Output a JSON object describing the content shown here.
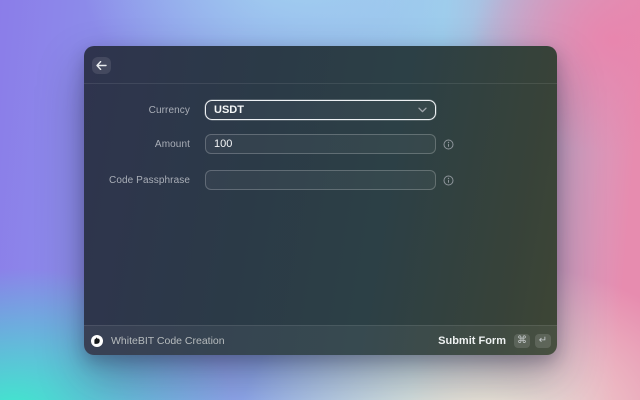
{
  "theme": {
    "bg_purple": "#8b7de9",
    "bg_periwinkle": "#8fa9ec",
    "bg_sky": "#9ccbeb",
    "bg_pink": "#e78caf",
    "bg_teal": "#3fe9cd",
    "bg_cream": "#f2ecd9",
    "window_left": "#2f344e",
    "window_right": "#3e4635",
    "focus_border": "#edf0f3"
  },
  "window": {
    "header": {
      "back_icon": "arrow-left"
    },
    "form": {
      "fields": [
        {
          "label": "Currency",
          "type": "dropdown",
          "value": "USDT",
          "has_info": false
        },
        {
          "label": "Amount",
          "type": "text",
          "value": "100",
          "placeholder": "",
          "has_info": true
        },
        {
          "label": "Code Passphrase",
          "type": "password",
          "value": "",
          "placeholder": "",
          "has_info": true
        }
      ]
    },
    "footer": {
      "app_icon": "whitebit-logo",
      "app_name": "WhiteBIT Code Creation",
      "action_label": "Submit Form",
      "shortcut_keys": [
        "⌘",
        "↵"
      ]
    }
  }
}
